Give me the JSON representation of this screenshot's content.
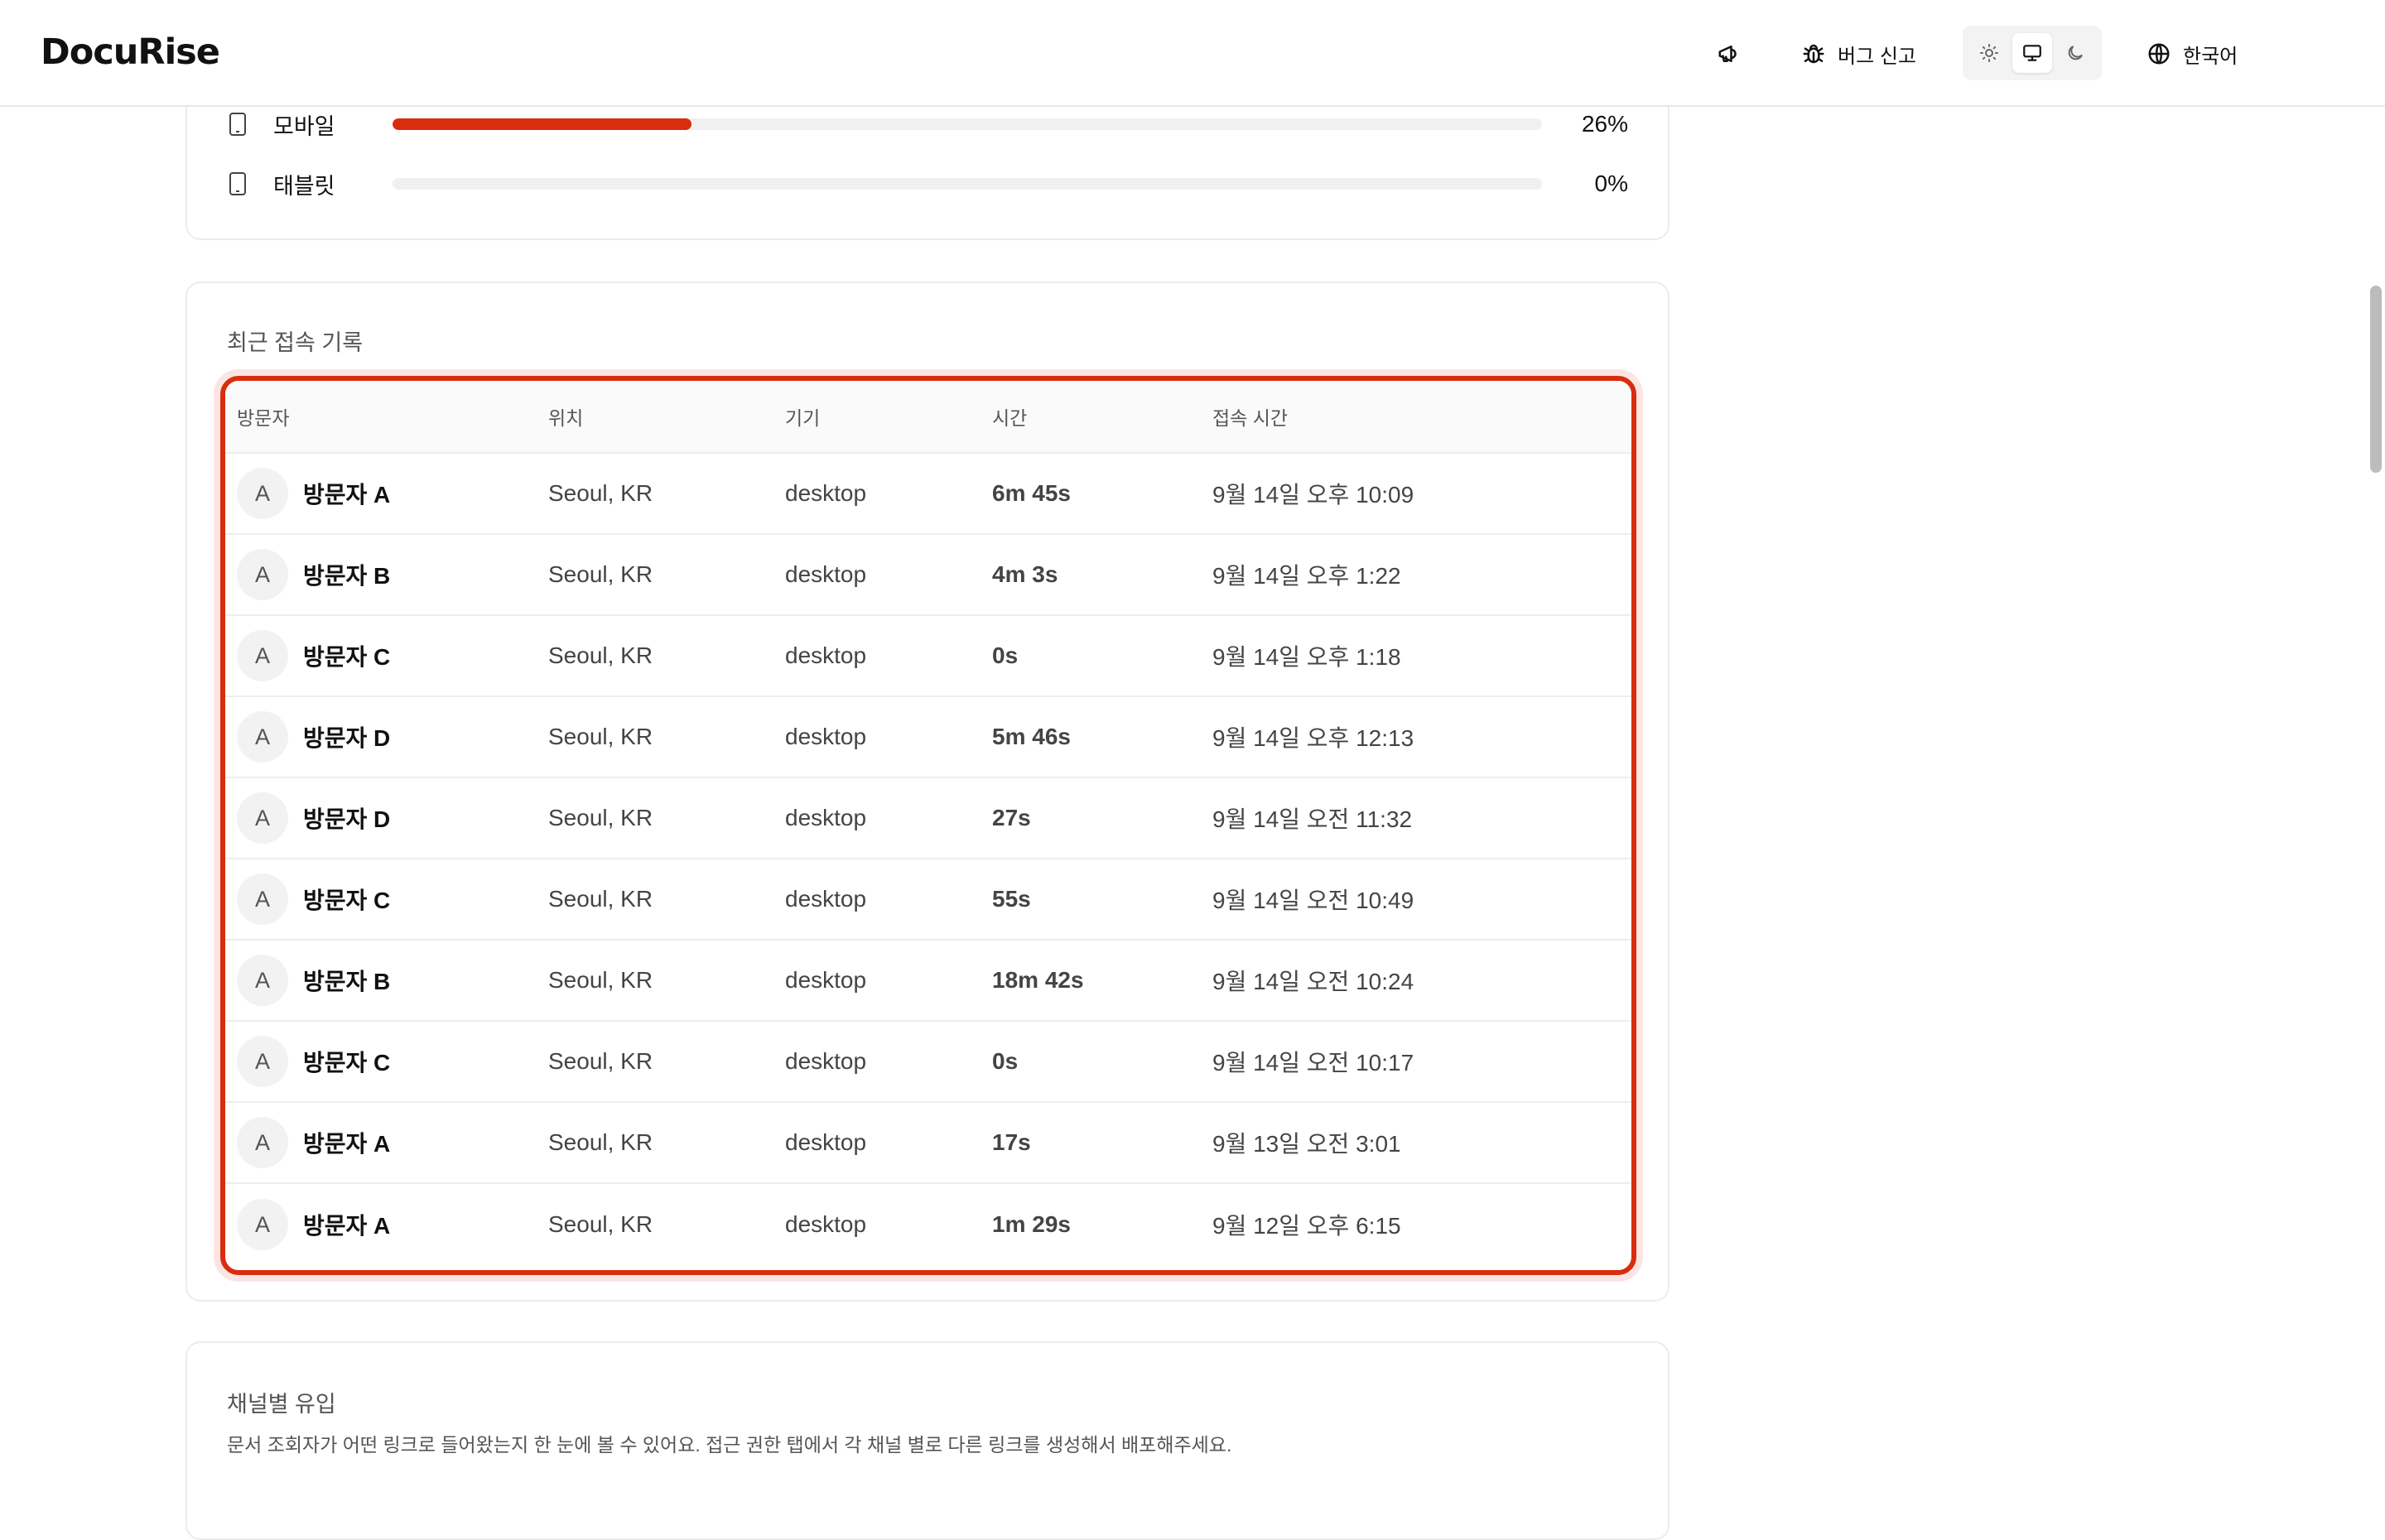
{
  "header": {
    "logo": "DocuRise",
    "bug_report_label": "버그 신고",
    "language_label": "한국어"
  },
  "device_stats": [
    {
      "label": "모바일",
      "percent_label": "26%",
      "fraction": 0.26
    },
    {
      "label": "태블릿",
      "percent_label": "0%",
      "fraction": 0.0
    }
  ],
  "recent_visits": {
    "title": "최근 접속 기록",
    "columns": [
      "방문자",
      "위치",
      "기기",
      "시간",
      "접속 시간"
    ],
    "rows": [
      {
        "avatar": "A",
        "visitor": "방문자 A",
        "location": "Seoul, KR",
        "device": "desktop",
        "duration": "6m 45s",
        "accessed": "9월 14일 오후 10:09"
      },
      {
        "avatar": "A",
        "visitor": "방문자 B",
        "location": "Seoul, KR",
        "device": "desktop",
        "duration": "4m 3s",
        "accessed": "9월 14일 오후 1:22"
      },
      {
        "avatar": "A",
        "visitor": "방문자 C",
        "location": "Seoul, KR",
        "device": "desktop",
        "duration": "0s",
        "accessed": "9월 14일 오후 1:18"
      },
      {
        "avatar": "A",
        "visitor": "방문자 D",
        "location": "Seoul, KR",
        "device": "desktop",
        "duration": "5m 46s",
        "accessed": "9월 14일 오후 12:13"
      },
      {
        "avatar": "A",
        "visitor": "방문자 D",
        "location": "Seoul, KR",
        "device": "desktop",
        "duration": "27s",
        "accessed": "9월 14일 오전 11:32"
      },
      {
        "avatar": "A",
        "visitor": "방문자 C",
        "location": "Seoul, KR",
        "device": "desktop",
        "duration": "55s",
        "accessed": "9월 14일 오전 10:49"
      },
      {
        "avatar": "A",
        "visitor": "방문자 B",
        "location": "Seoul, KR",
        "device": "desktop",
        "duration": "18m 42s",
        "accessed": "9월 14일 오전 10:24"
      },
      {
        "avatar": "A",
        "visitor": "방문자 C",
        "location": "Seoul, KR",
        "device": "desktop",
        "duration": "0s",
        "accessed": "9월 14일 오전 10:17"
      },
      {
        "avatar": "A",
        "visitor": "방문자 A",
        "location": "Seoul, KR",
        "device": "desktop",
        "duration": "17s",
        "accessed": "9월 13일 오전 3:01"
      },
      {
        "avatar": "A",
        "visitor": "방문자 A",
        "location": "Seoul, KR",
        "device": "desktop",
        "duration": "1m 29s",
        "accessed": "9월 12일 오후 6:15"
      }
    ]
  },
  "channel": {
    "title": "채널별 유입",
    "description": "문서 조회자가 어떤 링크로 들어왔는지 한 눈에 볼 수 있어요. 접근 권한 탭에서 각 채널 별로 다른 링크를 생성해서 배포해주세요."
  },
  "colors": {
    "accent": "#d92d0f",
    "track": "#f0f0f0",
    "border": "#ececec"
  },
  "icons": {
    "announce": "megaphone-icon",
    "bug": "bug-icon",
    "light": "sun-icon",
    "system": "monitor-icon",
    "dark": "moon-icon",
    "language": "globe-icon",
    "device": "mobile-device-icon"
  }
}
